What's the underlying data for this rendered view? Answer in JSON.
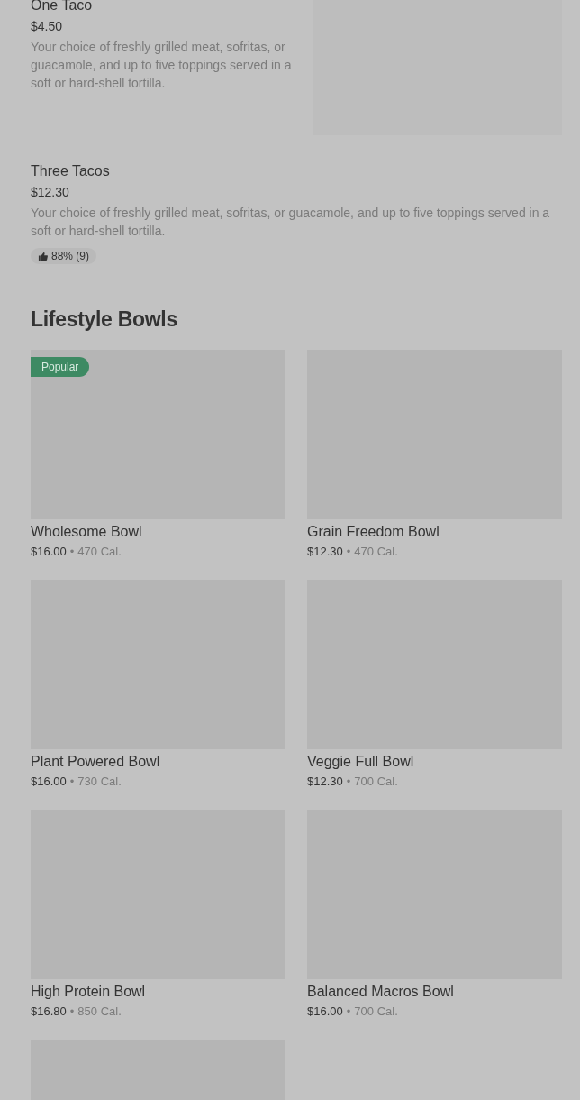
{
  "items": [
    {
      "kind": "with-image",
      "name": "One Taco",
      "price": "$4.50",
      "description": "Your choice of freshly grilled meat, sofritas, or guacamole, and up to five toppings served in a soft or hard-shell tortilla."
    },
    {
      "kind": "text-only",
      "name": "Three Tacos",
      "price": "$12.30",
      "description": "Your choice of freshly grilled meat, sofritas, or guacamole, and up to five toppings served in a soft or hard-shell tortilla.",
      "rating": "88% (9)"
    }
  ],
  "section": {
    "title": "Lifestyle Bowls",
    "bowls": [
      {
        "kind": "product",
        "badge": "Popular",
        "name": "Wholesome Bowl",
        "price": "$16.00",
        "separator": "•",
        "calories": "470 Cal."
      },
      {
        "kind": "product",
        "name": "Grain Freedom Bowl",
        "price": "$12.30",
        "separator": "•",
        "calories": "470 Cal."
      },
      {
        "kind": "product",
        "name": "Plant Powered Bowl",
        "price": "$16.00",
        "separator": "•",
        "calories": "730 Cal."
      },
      {
        "kind": "product",
        "name": "Veggie Full Bowl",
        "price": "$12.30",
        "separator": "•",
        "calories": "700 Cal."
      },
      {
        "kind": "product",
        "name": "High Protein Bowl",
        "price": "$16.80",
        "separator": "•",
        "calories": "850 Cal."
      },
      {
        "kind": "product",
        "name": "Balanced Macros Bowl",
        "price": "$16.00",
        "separator": "•",
        "calories": "700 Cal."
      },
      {
        "kind": "picture"
      }
    ]
  }
}
